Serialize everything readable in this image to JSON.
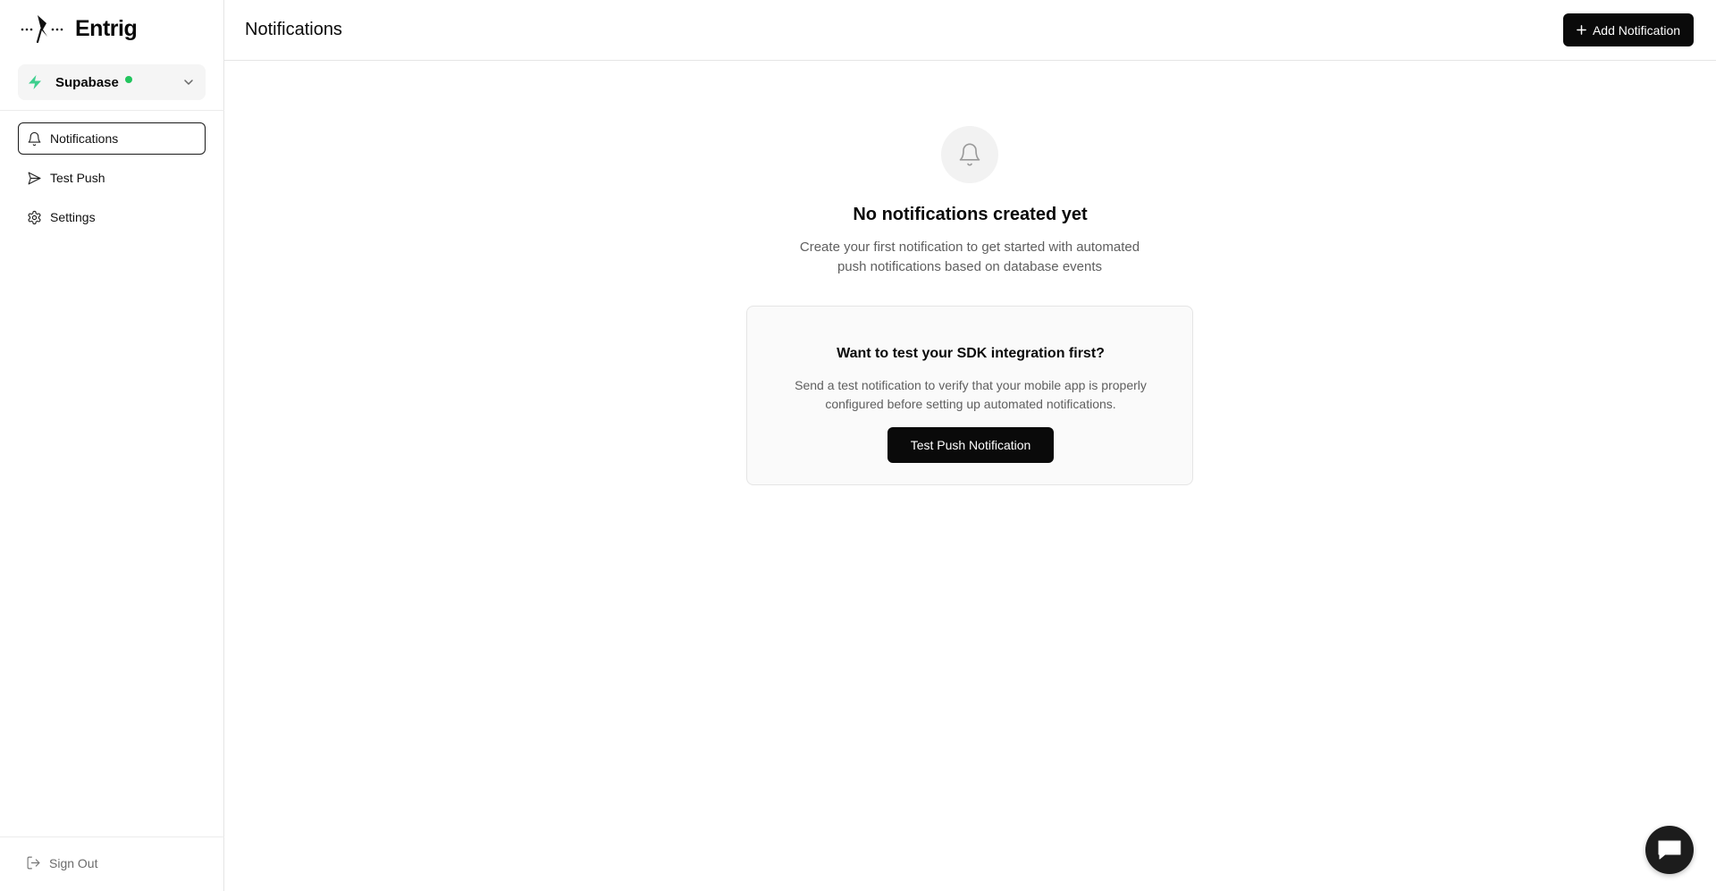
{
  "app": {
    "name": "Entrig"
  },
  "sidebar": {
    "project": {
      "name": "Supabase",
      "status_color": "#22c55e",
      "icon": "bolt-icon"
    },
    "items": [
      {
        "label": "Notifications",
        "icon": "bell-icon",
        "active": true
      },
      {
        "label": "Test Push",
        "icon": "send-icon",
        "active": false
      },
      {
        "label": "Settings",
        "icon": "gear-icon",
        "active": false
      }
    ],
    "sign_out": {
      "label": "Sign Out",
      "icon": "sign-out-icon"
    }
  },
  "header": {
    "title": "Notifications",
    "add_button_label": "Add Notification"
  },
  "empty_state": {
    "title": "No notifications created yet",
    "description": "Create your first notification to get started with automated push notifications based on database events"
  },
  "test_card": {
    "title": "Want to test your SDK integration first?",
    "description": "Send a test notification to verify that your mobile app is properly configured before setting up automated notifications.",
    "button_label": "Test Push Notification"
  },
  "colors": {
    "accent": "#0a0a0a",
    "status_online": "#22c55e",
    "project_icon": "#3ecf8e"
  }
}
